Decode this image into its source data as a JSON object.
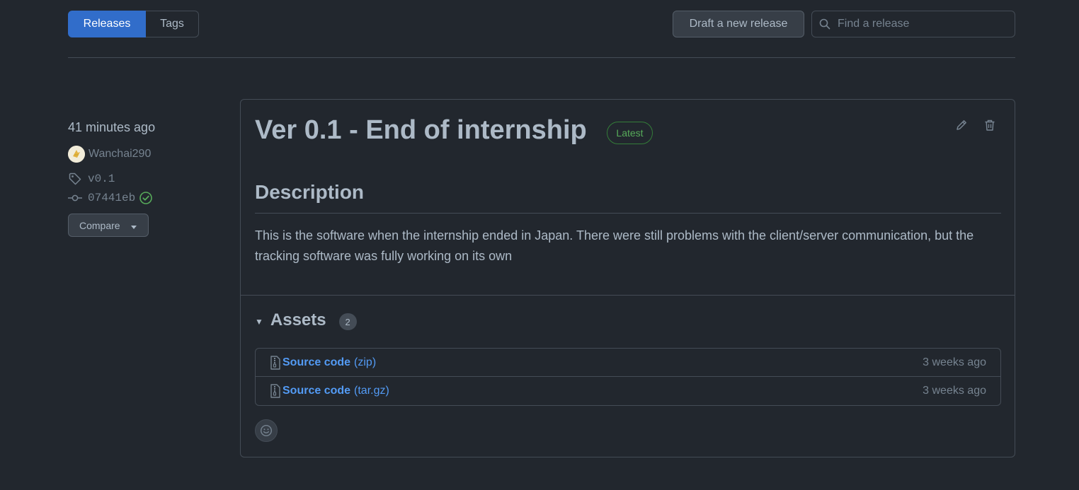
{
  "subnav": {
    "releases_label": "Releases",
    "tags_label": "Tags"
  },
  "header": {
    "draft_button": "Draft a new release",
    "search_placeholder": "Find a release"
  },
  "meta": {
    "time": "41 minutes ago",
    "author": "Wanchai290",
    "tag": "v0.1",
    "commit": "07441eb",
    "compare_label": "Compare"
  },
  "release": {
    "title": "Ver 0.1 - End of internship",
    "badge": "Latest",
    "description_heading": "Description",
    "description_text": "This is the software when the internship ended in Japan. There were still problems with the client/server communication, but the tracking software was fully working on its own",
    "assets_label": "Assets",
    "assets_count": "2",
    "assets": [
      {
        "name": "Source code",
        "format": "(zip)",
        "time": "3 weeks ago"
      },
      {
        "name": "Source code",
        "format": "(tar.gz)",
        "time": "3 weeks ago"
      }
    ]
  },
  "colors": {
    "accent": "#316dca",
    "link": "#539bf5",
    "success": "#57ab5a",
    "bg": "#22272e"
  },
  "icons": [
    "search-icon",
    "tag-icon",
    "commit-icon",
    "check-circle-icon",
    "triangle-down-icon",
    "pencil-icon",
    "trash-icon",
    "file-zip-icon",
    "smiley-icon"
  ]
}
